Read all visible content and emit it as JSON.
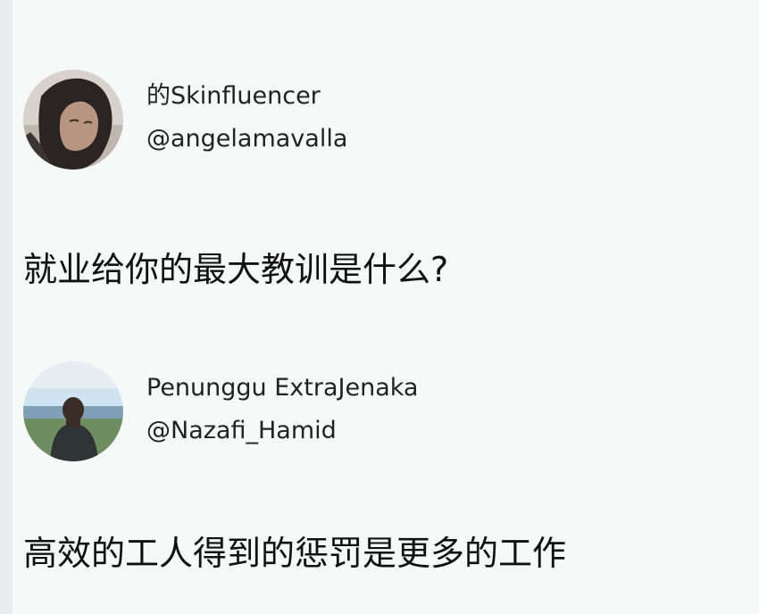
{
  "posts": [
    {
      "display_name": "的Skinfluencer",
      "handle": "@angelamavalla",
      "text": "就业给你的最大教训是什么?",
      "avatar": "user-avatar-photo"
    },
    {
      "display_name": "Penunggu ExtraJenaka",
      "handle": "@Nazafi_Hamid",
      "text": "高效的工人得到的惩罚是更多的工作",
      "avatar": "user-avatar-photo"
    }
  ]
}
